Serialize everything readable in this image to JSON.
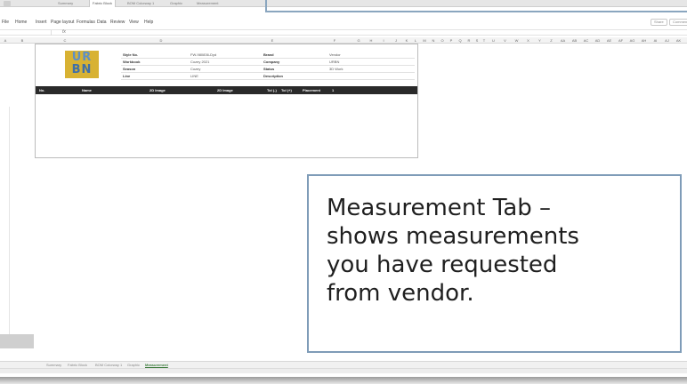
{
  "workbook_tabs": [
    "Summary",
    "Fabric Block",
    "BOM Colorway 1",
    "Graphic",
    "Measurement"
  ],
  "ribbon": {
    "menu": [
      "File",
      "Home",
      "Insert",
      "Page layout",
      "Formulas",
      "Data",
      "Review",
      "View",
      "Help"
    ],
    "buttons": [
      "Share",
      "Comments"
    ]
  },
  "formula_bar": {
    "fx": "fx",
    "value": ""
  },
  "columns": [
    "A",
    "B",
    "C",
    "D",
    "E",
    "F",
    "G",
    "H",
    "I",
    "J",
    "K",
    "L",
    "M",
    "N",
    "O",
    "P",
    "Q",
    "R",
    "S",
    "T",
    "U",
    "V",
    "W",
    "X",
    "Y",
    "Z",
    "AA",
    "AB",
    "AC",
    "AD",
    "AE",
    "AF",
    "AG",
    "AH",
    "AI",
    "AJ",
    "AK",
    "AL",
    "AM",
    "AN",
    "AO"
  ],
  "logo_text": [
    "UR",
    "BN"
  ],
  "fields_left": [
    {
      "label": "Style No.",
      "value": "FW-980836-Dyd"
    },
    {
      "label": "Workbook",
      "value": "Cozey 2021"
    },
    {
      "label": "Season",
      "value": "Cozey"
    },
    {
      "label": "Line",
      "value": "LINE"
    }
  ],
  "fields_right": [
    {
      "label": "Brand",
      "value": "Vendor"
    },
    {
      "label": "Company",
      "value": "URBN"
    },
    {
      "label": "Status",
      "value": "3D Work"
    },
    {
      "label": "Description",
      "value": ""
    }
  ],
  "table_headers": [
    "No.",
    "Name",
    "2D Image",
    "2D Image",
    "Tol (-)",
    "Tol (+)",
    "Placement",
    "1"
  ],
  "sheet_tabs": [
    "Summary",
    "Fabric Block",
    "BOM Colorway 1",
    "Graphic",
    "Measurement"
  ],
  "active_sheet_index": 4,
  "callout": {
    "lines": [
      "Measurement Tab –",
      "shows measurements",
      "you have requested",
      "from vendor."
    ]
  },
  "colors": {
    "accent_border": "#7f9cb8",
    "logo_bg": "#d8b233",
    "logo_fg": "#5d8fc7",
    "header_bg": "#2a2a2a"
  }
}
